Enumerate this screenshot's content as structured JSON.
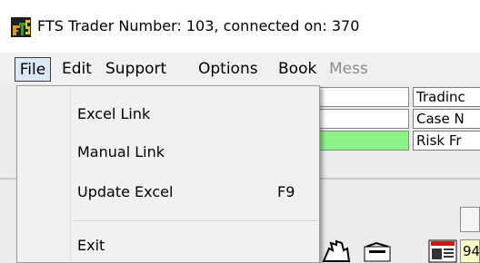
{
  "window": {
    "title": "FTS Trader Number: 103, connected on: 370"
  },
  "menubar": {
    "items": [
      {
        "label": "File",
        "active": true,
        "enabled": true
      },
      {
        "label": "Edit",
        "active": false,
        "enabled": true
      },
      {
        "label": "Support",
        "active": false,
        "enabled": true
      },
      {
        "label": "Options",
        "active": false,
        "enabled": true
      },
      {
        "label": "Book",
        "active": false,
        "enabled": true
      },
      {
        "label": "Mess",
        "active": false,
        "enabled": false
      }
    ]
  },
  "file_menu": {
    "items": [
      {
        "label": "Excel Link",
        "shortcut": ""
      },
      {
        "label": "Manual Link",
        "shortcut": ""
      },
      {
        "label": "Update Excel",
        "shortcut": "F9"
      },
      {
        "label": "Exit",
        "shortcut": ""
      }
    ]
  },
  "background": {
    "info_labels": [
      "Tradinc",
      "Case N",
      "Risk Fr"
    ],
    "toolbar_value": "94"
  },
  "colors": {
    "menu_active_bg": "#dbe8f6",
    "status_green": "#8ef28a",
    "toolbar_value_bg": "#ffffcc"
  }
}
